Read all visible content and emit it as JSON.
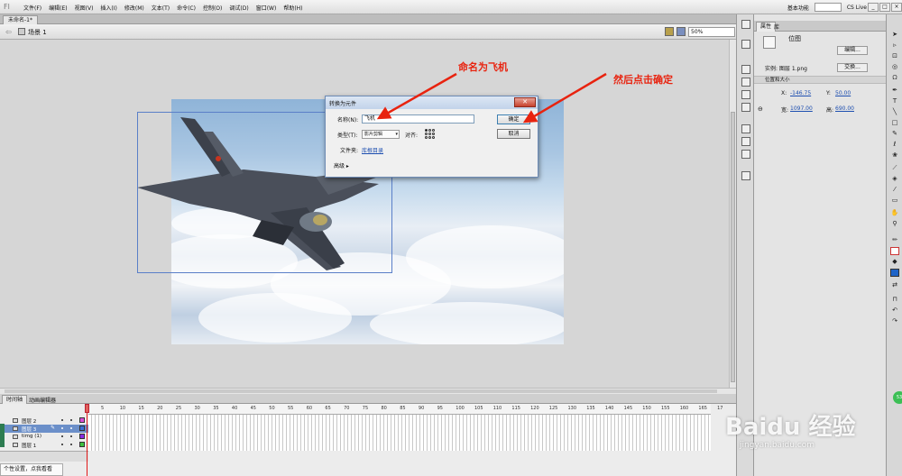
{
  "menubar": {
    "items": [
      "文件(F)",
      "编辑(E)",
      "视图(V)",
      "插入(I)",
      "修改(M)",
      "文本(T)",
      "命令(C)",
      "控制(O)",
      "调试(D)",
      "窗口(W)",
      "帮助(H)"
    ],
    "workspace": "基本功能",
    "cslive": "CS Live"
  },
  "doc_tab": "未命名-1*",
  "scene": {
    "label": "场景 1",
    "zoom": "50%"
  },
  "dialog": {
    "title": "转换为元件",
    "close": "✕",
    "name_label": "名称(N):",
    "name_value": "飞机",
    "type_label": "类型(T):",
    "type_value": "影片剪辑",
    "align_label": "对齐:",
    "folder_label": "文件夹:",
    "folder_value": "库根目录",
    "ok": "确定",
    "cancel": "取消",
    "advanced": "高级 ▸"
  },
  "annotations": {
    "name_hint": "命名为飞机",
    "ok_hint": "然后点击确定"
  },
  "timeline": {
    "tab_timeline": "时间轴",
    "tab_motion": "动画编辑器",
    "ruler": [
      "5",
      "10",
      "15",
      "20",
      "25",
      "30",
      "35",
      "40",
      "45",
      "50",
      "55",
      "60",
      "65",
      "70",
      "75",
      "80",
      "85",
      "90",
      "95",
      "100",
      "105",
      "110",
      "115",
      "120",
      "125",
      "130",
      "135",
      "140",
      "145",
      "150",
      "155",
      "160",
      "165",
      "17"
    ],
    "layers": [
      {
        "name": "图层 2",
        "color": "#d94fd9",
        "selected": false
      },
      {
        "name": "图层 3",
        "color": "#3a6fd8",
        "selected": true
      },
      {
        "name": "timg (1)",
        "color": "#8a2be2",
        "selected": false
      },
      {
        "name": "图层 1",
        "color": "#3fbf3f",
        "selected": false
      }
    ]
  },
  "status_tip": "个性设置，点我看看",
  "properties": {
    "tab_props": "属性",
    "tab_lib": "库",
    "type_label": "位图",
    "edit_btn": "编辑...",
    "instance_label": "实例: 图层 1.png",
    "swap_btn": "交换...",
    "section": "位置和大小",
    "x_label": "X:",
    "x_value": "-146.75",
    "y_label": "Y:",
    "y_value": "50.00",
    "w_label": "宽:",
    "w_value": "1097.00",
    "h_label": "高:",
    "h_value": "690.00"
  },
  "watermark": {
    "brand": "Baidu 经验",
    "url": "jingyan.baidu.com"
  },
  "badge": "53"
}
